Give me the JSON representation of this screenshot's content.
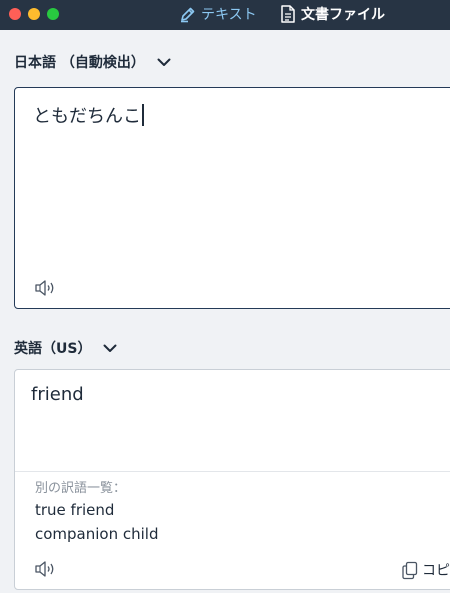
{
  "titlebar": {
    "tabs": [
      {
        "label": "テキスト",
        "icon": "pencil-icon",
        "active": true
      },
      {
        "label": "文書ファイル",
        "icon": "document-icon",
        "active": false
      }
    ],
    "colors": {
      "bar": "#273444",
      "active_tab": "#8cc8f2"
    }
  },
  "source": {
    "language": "日本語 （自動検出）",
    "text": "ともだちんこ",
    "speaker_icon": "speaker-icon"
  },
  "target": {
    "language": "英語（US）",
    "translation": "friend",
    "alternatives_title": "別の訳語一覧：",
    "alternatives": [
      "true friend",
      "companion child"
    ],
    "speaker_icon": "speaker-icon",
    "copy_label": "コピ"
  }
}
